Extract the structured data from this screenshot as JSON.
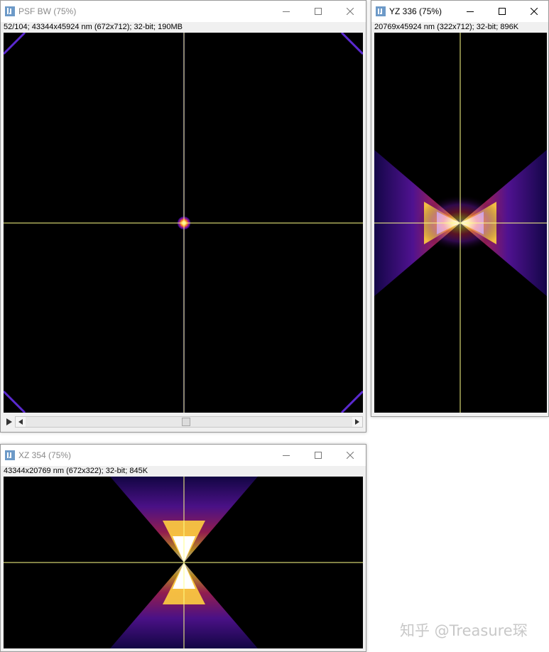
{
  "windows": {
    "psf": {
      "title": "PSF BW (75%)",
      "info": "52/104; 43344x45924 nm (672x712); 32-bit; 190MB",
      "slice": {
        "current": 52,
        "total": 104
      }
    },
    "yz": {
      "title": "YZ 336 (75%)",
      "info": "20769x45924 nm (322x712); 32-bit; 896K"
    },
    "xz": {
      "title": "XZ 354 (75%)",
      "info": "43344x20769 nm (672x322); 32-bit; 845K"
    }
  },
  "colors": {
    "crosshair": "#ffff88",
    "lut": [
      "#000000",
      "#3a0b8f",
      "#8a19c8",
      "#e23a6a",
      "#ffb400",
      "#ffffff"
    ]
  },
  "icons": {
    "app": "imagej-icon",
    "minimize": "minimize-icon",
    "maximize": "maximize-icon",
    "close": "close-icon",
    "play": "play-icon"
  },
  "watermark": "知乎 @Treasure琛"
}
